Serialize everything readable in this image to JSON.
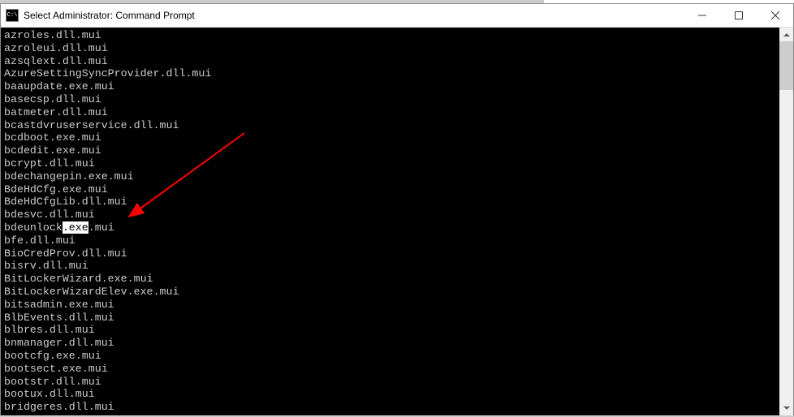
{
  "window": {
    "title": "Select Administrator: Command Prompt"
  },
  "console": {
    "lines": [
      "azroles.dll.mui",
      "azroleui.dll.mui",
      "azsqlext.dll.mui",
      "AzureSettingSyncProvider.dll.mui",
      "baaupdate.exe.mui",
      "basecsp.dll.mui",
      "batmeter.dll.mui",
      "bcastdvruserservice.dll.mui",
      "bcdboot.exe.mui",
      "bcdedit.exe.mui",
      "bcrypt.dll.mui",
      "bdechangepin.exe.mui",
      "BdeHdCfg.exe.mui",
      "BdeHdCfgLib.dll.mui",
      "bdesvc.dll.mui",
      "bdeunlock.exe.mui",
      "bfe.dll.mui",
      "BioCredProv.dll.mui",
      "bisrv.dll.mui",
      "BitLockerWizard.exe.mui",
      "BitLockerWizardElev.exe.mui",
      "bitsadmin.exe.mui",
      "BlbEvents.dll.mui",
      "blbres.dll.mui",
      "bnmanager.dll.mui",
      "bootcfg.exe.mui",
      "bootsect.exe.mui",
      "bootstr.dll.mui",
      "bootux.dll.mui",
      "bridgeres.dll.mui"
    ],
    "selection": {
      "line_index": 15,
      "before": "bdeunlock",
      "marked": ".exe",
      "after": ".mui"
    }
  },
  "annotation": {
    "arrow_color": "#ff0000"
  }
}
